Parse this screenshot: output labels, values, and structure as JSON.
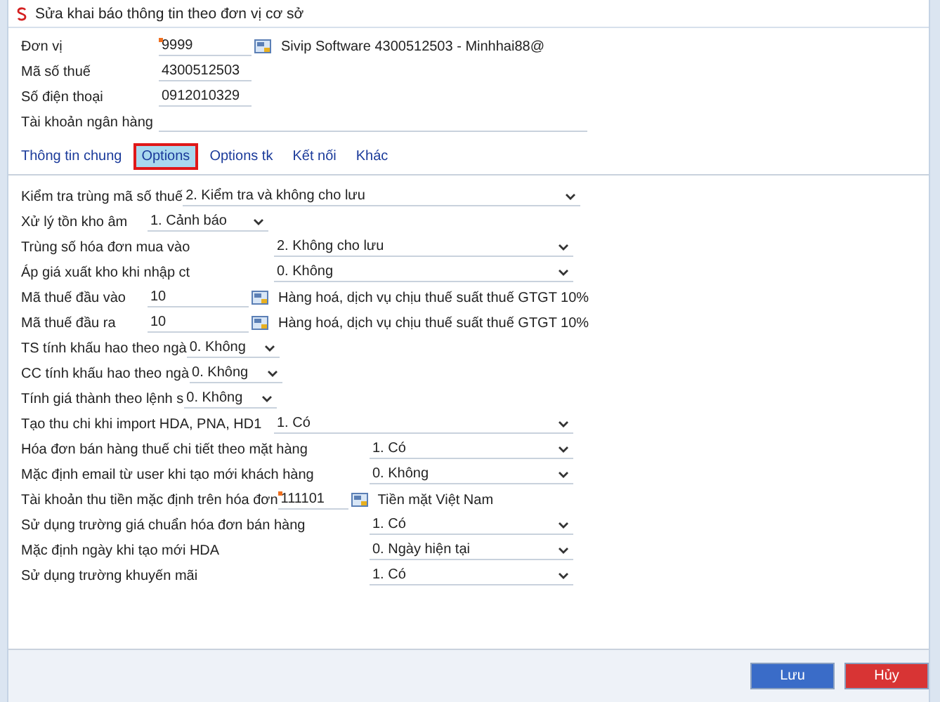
{
  "window": {
    "title": "Sửa khai báo thông tin theo đơn vị cơ sở"
  },
  "header_fields": [
    {
      "kind": "lookup",
      "label": "Đơn vị",
      "value": "9999",
      "required": true,
      "description": "Sivip Software 4300512503 - Minhhai88@"
    },
    {
      "kind": "text",
      "label": "Mã số thuế",
      "value": "4300512503",
      "required": false
    },
    {
      "kind": "text",
      "label": "Số điện thoại",
      "value": "0912010329",
      "required": false
    },
    {
      "kind": "wide",
      "label": "Tài khoản ngân hàng",
      "required": false
    }
  ],
  "tabs": [
    {
      "label": "Thông tin chung",
      "selected": false
    },
    {
      "label": "Options",
      "selected": true
    },
    {
      "label": "Options tk",
      "selected": false
    },
    {
      "label": "Kết nối",
      "selected": false
    },
    {
      "label": "Khác",
      "selected": false
    }
  ],
  "options": [
    {
      "kind": "select",
      "label": "Kiểm tra trùng mã số thuế",
      "value": "2. Kiểm tra và không cho lưu",
      "required": false
    },
    {
      "kind": "select",
      "label": "Xử lý tồn kho âm",
      "value": "1. Cảnh báo",
      "required": false
    },
    {
      "kind": "select",
      "label": "Trùng số hóa đơn mua vào",
      "value": "2. Không cho lưu",
      "required": false
    },
    {
      "kind": "select",
      "label": "Áp giá xuất kho khi nhập ct",
      "value": "0. Không",
      "required": false
    },
    {
      "kind": "lookup",
      "label": "Mã thuế đầu vào",
      "value": "10",
      "description": "Hàng hoá, dịch vụ chịu thuế suất thuế GTGT 10%",
      "required": false
    },
    {
      "kind": "lookup",
      "label": "Mã thuế đầu ra",
      "value": "10",
      "description": "Hàng hoá, dịch vụ chịu thuế suất thuế GTGT 10%",
      "required": false
    },
    {
      "kind": "select",
      "label": "TS tính khấu hao theo ngà",
      "value": "0. Không",
      "required": false
    },
    {
      "kind": "select",
      "label": "CC tính khấu hao theo ngà",
      "value": "0. Không",
      "required": false
    },
    {
      "kind": "select",
      "label": "Tính giá thành theo lệnh s",
      "value": "0. Không",
      "required": false
    },
    {
      "kind": "select",
      "label": "Tạo thu chi khi import HDA, PNA, HD1",
      "value": "1. Có",
      "required": false
    },
    {
      "kind": "select",
      "label": "Hóa đơn bán hàng thuế chi tiết theo mặt hàng",
      "value": "1. Có",
      "required": false
    },
    {
      "kind": "select",
      "label": "Mặc định email từ user khi tạo mới khách hàng",
      "value": "0. Không",
      "required": false
    },
    {
      "kind": "lookup",
      "label": "Tài khoản thu tiền mặc định trên hóa đơn",
      "value": "111101",
      "description": "Tiền mặt Việt Nam",
      "required": true
    },
    {
      "kind": "select",
      "label": "Sử dụng trường giá chuẩn hóa đơn bán hàng",
      "value": "1. Có",
      "required": false
    },
    {
      "kind": "select",
      "label": "Mặc định ngày khi tạo mới HDA",
      "value": "0. Ngày hiện tại",
      "required": false
    },
    {
      "kind": "select",
      "label": "Sử dụng trường khuyến mãi",
      "value": "1. Có",
      "required": false
    }
  ],
  "buttons": [
    {
      "kind": "primary",
      "label": "Lưu"
    },
    {
      "kind": "danger",
      "label": "Hủy"
    }
  ]
}
